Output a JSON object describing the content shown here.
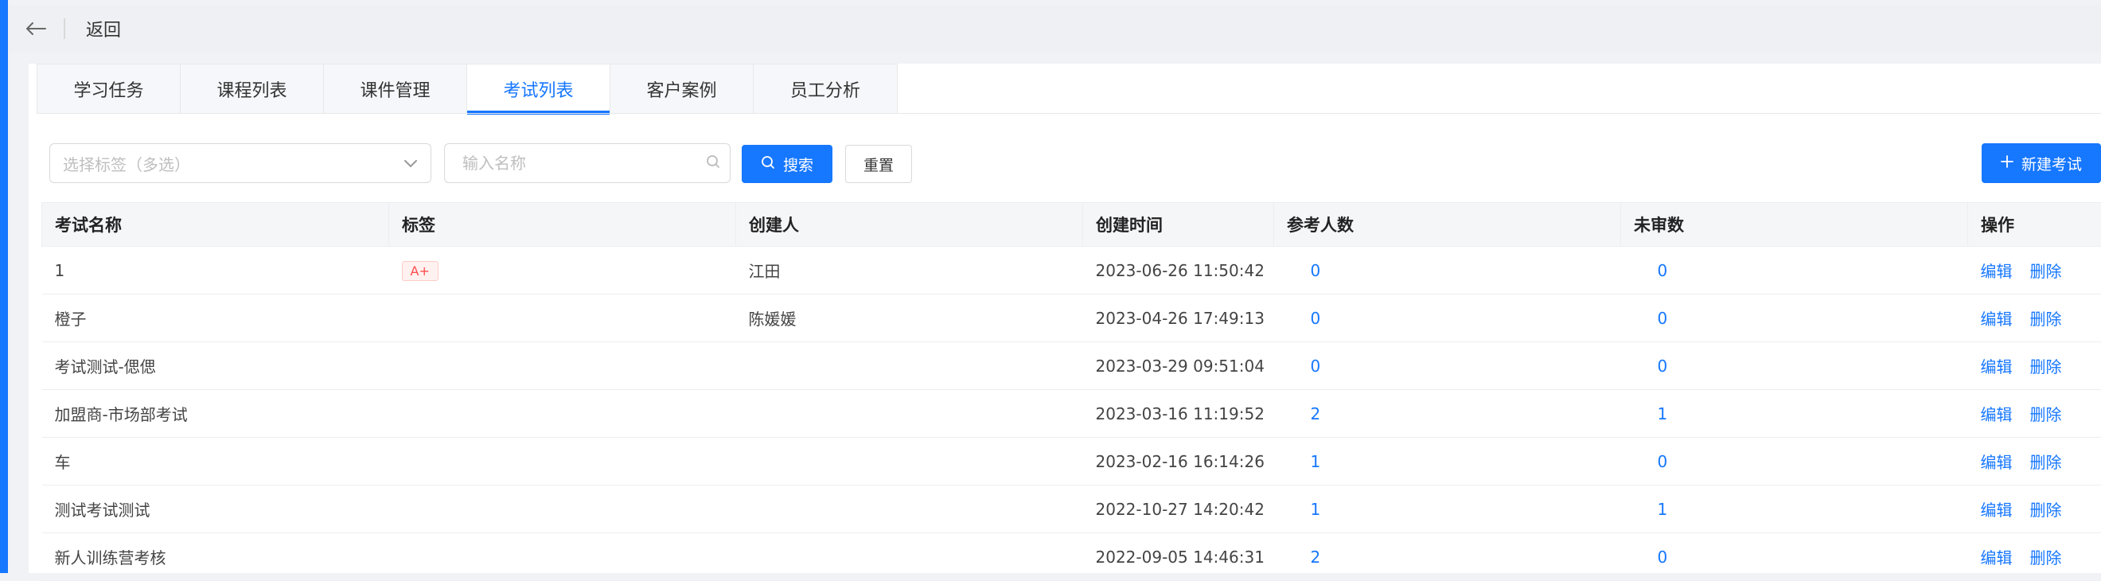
{
  "header": {
    "back_label": "返回"
  },
  "tabs": [
    {
      "label": "学习任务",
      "active": false
    },
    {
      "label": "课程列表",
      "active": false
    },
    {
      "label": "课件管理",
      "active": false
    },
    {
      "label": "考试列表",
      "active": true
    },
    {
      "label": "客户案例",
      "active": false
    },
    {
      "label": "员工分析",
      "active": false
    }
  ],
  "toolbar": {
    "tag_select_placeholder": "选择标签（多选）",
    "name_input_placeholder": "输入名称",
    "search_label": "搜索",
    "reset_label": "重置",
    "new_exam_label": "新建考试"
  },
  "table": {
    "columns": [
      "考试名称",
      "标签",
      "创建人",
      "创建时间",
      "参考人数",
      "未审数",
      "操作"
    ],
    "rows": [
      {
        "name": "1",
        "tag": "A+",
        "creator": "江田",
        "created": "2023-06-26 11:50:42",
        "participants": "0",
        "unreviewed": "0"
      },
      {
        "name": "橙子",
        "tag": "",
        "creator": "陈媛媛",
        "created": "2023-04-26 17:49:13",
        "participants": "0",
        "unreviewed": "0"
      },
      {
        "name": "考试测试-偲偲",
        "tag": "",
        "creator": "",
        "created": "2023-03-29 09:51:04",
        "participants": "0",
        "unreviewed": "0"
      },
      {
        "name": "加盟商-市场部考试",
        "tag": "",
        "creator": "",
        "created": "2023-03-16 11:19:52",
        "participants": "2",
        "unreviewed": "1"
      },
      {
        "name": "车",
        "tag": "",
        "creator": "",
        "created": "2023-02-16 16:14:26",
        "participants": "1",
        "unreviewed": "0"
      },
      {
        "name": "测试考试测试",
        "tag": "",
        "creator": "",
        "created": "2022-10-27 14:20:42",
        "participants": "1",
        "unreviewed": "1"
      },
      {
        "name": "新人训练营考核",
        "tag": "",
        "creator": "",
        "created": "2022-09-05 14:46:31",
        "participants": "2",
        "unreviewed": "0"
      }
    ],
    "edit_label": "编辑",
    "delete_label": "删除"
  },
  "colors": {
    "accent": "#1677ff",
    "tag_text": "#ff4d4f",
    "tag_bg": "#fff1f0"
  }
}
